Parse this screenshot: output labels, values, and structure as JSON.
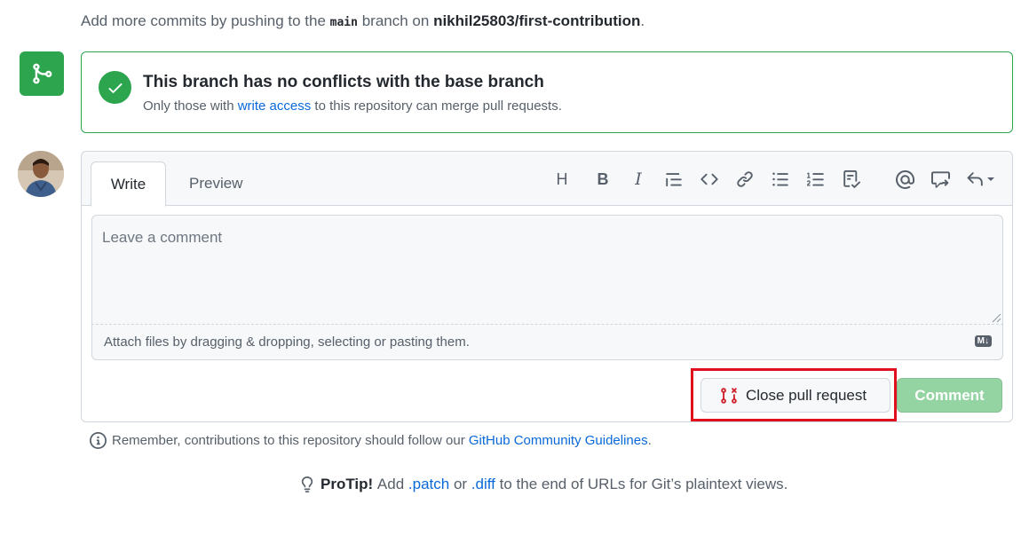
{
  "push_note": {
    "prefix": "Add more commits by pushing to the",
    "branch": "main",
    "middle": "branch on",
    "repo": "nikhil25803/first-contribution",
    "suffix": "."
  },
  "merge_status": {
    "title": "This branch has no conflicts with the base branch",
    "sub_prefix": "Only those with",
    "sub_link": "write access",
    "sub_suffix": "to this repository can merge pull requests."
  },
  "comment": {
    "tabs": {
      "write": "Write",
      "preview": "Preview"
    },
    "toolbar": {
      "heading": "H",
      "bold": "B",
      "italic": "I",
      "icons": [
        "quote-icon",
        "code-icon",
        "link-icon",
        "bulleted-list-icon",
        "numbered-list-icon",
        "task-list-icon",
        "mention-icon",
        "reference-icon",
        "reply-icon"
      ]
    },
    "placeholder": "Leave a comment",
    "attach_text": "Attach files by dragging & dropping, selecting or pasting them.",
    "markdown_badge": "M↓"
  },
  "buttons": {
    "close": "Close pull request",
    "comment": "Comment"
  },
  "remember": {
    "prefix": "Remember, contributions to this repository should follow our",
    "link": "GitHub Community Guidelines",
    "suffix": "."
  },
  "protip": {
    "label": "ProTip!",
    "pre": "Add",
    "patch": ".patch",
    "or": "or",
    "diff": ".diff",
    "post": "to the end of URLs for Git’s plaintext views."
  },
  "colors": {
    "success": "#2da44e",
    "link": "#0969da",
    "highlight": "#e0101d",
    "danger": "#cf222e",
    "comment_disabled": "#94d3a2"
  }
}
